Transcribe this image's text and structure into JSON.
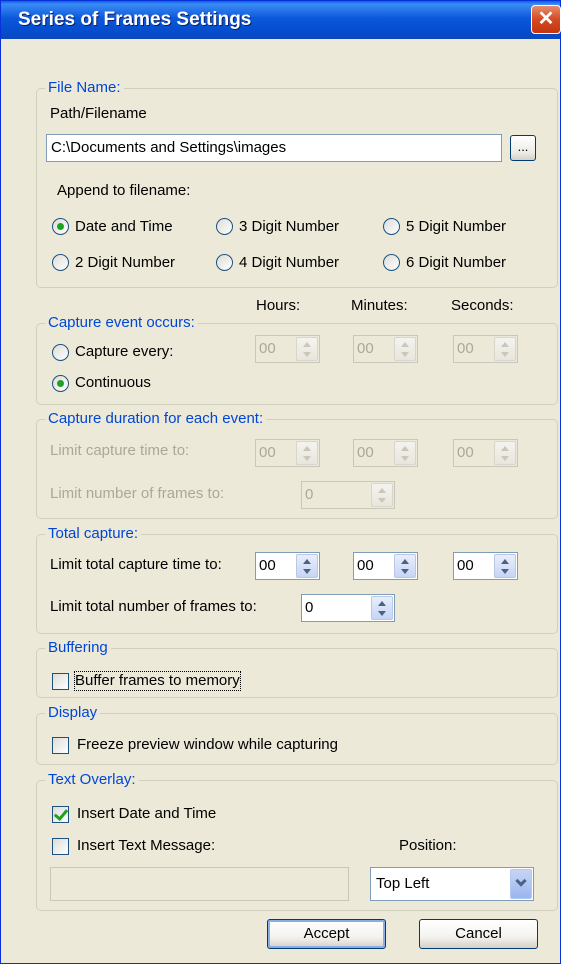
{
  "window": {
    "title": "Series of Frames Settings",
    "close_glyph": "✕"
  },
  "file_name": {
    "legend": "File Name:",
    "path_label": "Path/Filename",
    "path_value": "C:\\Documents and Settings\\images",
    "browse_label": "...",
    "append_label": "Append to filename:",
    "options": [
      "Date and Time",
      "3 Digit Number",
      "5 Digit Number",
      "2 Digit Number",
      "4 Digit Number",
      "6 Digit Number"
    ],
    "selected": "Date and Time"
  },
  "capture_event": {
    "legend": "Capture event occurs:",
    "hours_label": "Hours:",
    "minutes_label": "Minutes:",
    "seconds_label": "Seconds:",
    "capture_every_label": "Capture every:",
    "continuous_label": "Continuous",
    "selected": "Continuous",
    "hours": "00",
    "minutes": "00",
    "seconds": "00"
  },
  "capture_duration": {
    "legend": "Capture duration for each event:",
    "limit_time_label": "Limit capture time to:",
    "limit_frames_label": "Limit number of frames to:",
    "hours": "00",
    "minutes": "00",
    "seconds": "00",
    "frames": "0"
  },
  "total_capture": {
    "legend": "Total capture:",
    "limit_time_label": "Limit total capture time to:",
    "limit_frames_label": "Limit total number of frames to:",
    "hours": "00",
    "minutes": "00",
    "seconds": "00",
    "frames": "0"
  },
  "buffering": {
    "legend": "Buffering",
    "buffer_label": "Buffer frames to memory",
    "checked": false
  },
  "display": {
    "legend": "Display",
    "freeze_label": "Freeze preview window while capturing",
    "checked": false
  },
  "text_overlay": {
    "legend": "Text Overlay:",
    "insert_datetime_label": "Insert Date and Time",
    "insert_datetime_checked": true,
    "insert_message_label": "Insert Text Message:",
    "insert_message_checked": false,
    "message_value": "",
    "position_label": "Position:",
    "position_value": "Top Left"
  },
  "buttons": {
    "accept": "Accept",
    "cancel": "Cancel"
  },
  "colors": {
    "titlebar": "#0550D2",
    "dialog_bg": "#ECE9D8",
    "legend_text": "#0046D5",
    "check_green": "#21A121",
    "close_red": "#D54A22"
  }
}
